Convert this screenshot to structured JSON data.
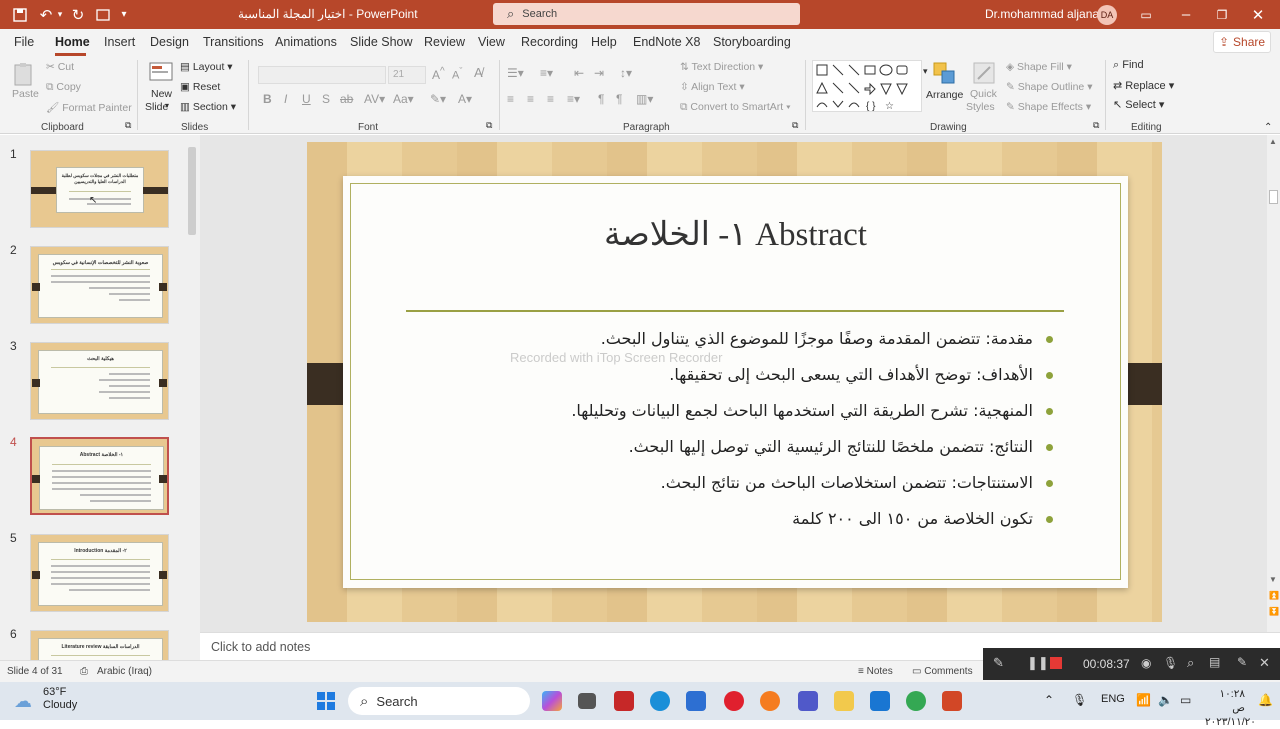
{
  "titlebar": {
    "doc_title": "اختيار المجلة المناسبة",
    "app_name": "PowerPoint",
    "search_label": "Search",
    "user_name": "Dr.mohammad aljanabi",
    "avatar_initials": "DA"
  },
  "menu": {
    "tabs": [
      "File",
      "Home",
      "Insert",
      "Design",
      "Transitions",
      "Animations",
      "Slide Show",
      "Review",
      "View",
      "Recording",
      "Help",
      "EndNote X8",
      "Storyboarding"
    ],
    "share_label": "Share"
  },
  "ribbon": {
    "clipboard": {
      "paste": "Paste",
      "cut": "Cut",
      "copy": "Copy",
      "format_painter": "Format Painter",
      "label": "Clipboard"
    },
    "slides": {
      "new_slide_1": "New",
      "new_slide_2": "Slide",
      "layout": "Layout",
      "reset": "Reset",
      "section": "Section",
      "label": "Slides"
    },
    "font": {
      "size": "21",
      "label": "Font"
    },
    "paragraph": {
      "text_direction": "Text Direction",
      "align_text": "Align Text",
      "smartart": "Convert to SmartArt",
      "label": "Paragraph"
    },
    "drawing": {
      "arrange": "Arrange",
      "quick_styles_1": "Quick",
      "quick_styles_2": "Styles",
      "shape_fill": "Shape Fill",
      "shape_outline": "Shape Outline",
      "shape_effects": "Shape Effects",
      "label": "Drawing"
    },
    "editing": {
      "find": "Find",
      "replace": "Replace",
      "select": "Select",
      "label": "Editing"
    }
  },
  "thumbnails": [
    {
      "num": "1",
      "title": "متطلبات النشر في مجلات سكوبس لطلبة الدراسات العليا والتدريسيين"
    },
    {
      "num": "2",
      "title": "صعوبة النشر للتخصصات الإنسانية في سكوبس"
    },
    {
      "num": "3",
      "title": "هيكلية البحث"
    },
    {
      "num": "4",
      "title": "Abstract ١- الخلاصة"
    },
    {
      "num": "5",
      "title": "Introduction ٢- المقدمة"
    },
    {
      "num": "6",
      "title": "Literature review الدراسات السابقة"
    }
  ],
  "slide": {
    "title": "١- الخلاصة Abstract",
    "bullets": [
      "مقدمة: تتضمن المقدمة وصفًا موجزًا للموضوع الذي يتناول البحث.",
      "الأهداف: توضح الأهداف التي يسعى البحث إلى تحقيقها.",
      "المنهجية: تشرح الطريقة التي استخدمها الباحث لجمع البيانات وتحليلها.",
      "النتائج: تتضمن ملخصًا للنتائج الرئيسية التي توصل إليها البحث.",
      "الاستنتاجات: تتضمن استخلاصات الباحث من نتائج البحث.",
      "تكون الخلاصة من ١٥٠ الى ٢٠٠ كلمة"
    ],
    "watermark": "Recorded with iTop Screen Recorder"
  },
  "notes": {
    "placeholder": "Click to add notes"
  },
  "status": {
    "slide_counter": "Slide 4 of 31",
    "language": "Arabic (Iraq)",
    "notes_label": "Notes",
    "comments_label": "Comments"
  },
  "recorder": {
    "time": "00:08:37"
  },
  "taskbar": {
    "weather_temp": "63°F",
    "weather_desc": "Cloudy",
    "search_label": "Search",
    "lang": "ENG",
    "time": "١٠:٢٨ ص",
    "date": "٢٠٢٣/١١/٢٠"
  },
  "colors": {
    "accent": "#b7472a",
    "bullet": "#8ea23b",
    "rule": "#9aa044"
  }
}
